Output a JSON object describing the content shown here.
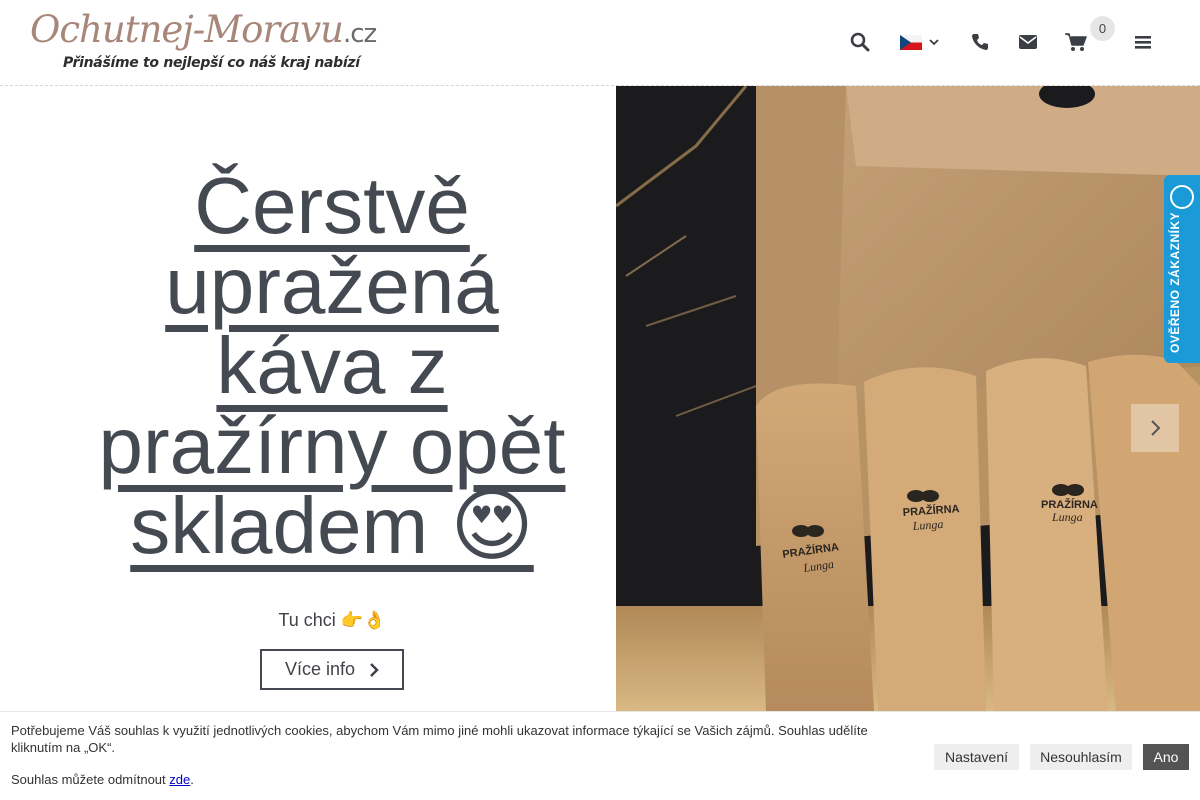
{
  "header": {
    "logo_main": "Ochutnej-Moravu",
    "logo_tld": ".cz",
    "logo_tagline": "Přinášíme to nejlepší co náš kraj nabízí",
    "cart_count": "0"
  },
  "hero": {
    "headline_lines": [
      "Čerstvě",
      "upražená",
      "káva z",
      "pražírny opět",
      "skladem 😍"
    ],
    "cta_text": "Tu chci 👉👌",
    "button_label": "Více info"
  },
  "verified_badge": {
    "label": "OVĚŘENO ZÁKAZNÍKY"
  },
  "cookie_bar": {
    "text": "Potřebujeme Váš souhlas k využití jednotlivých cookies, abychom Vám mimo jiné mohli ukazovat informace týkající se Vašich zájmů. Souhlas udělíte kliknutím na „OK“.",
    "revoke_text": "Souhlas můžete odmítnout ",
    "revoke_link": "zde",
    "revoke_end": ".",
    "btn_settings": "Nastavení",
    "btn_decline": "Nesouhlasím",
    "btn_accept": "Ano"
  },
  "bag_print": "PRAŽÍRNA",
  "bag_print2": "Lunga"
}
